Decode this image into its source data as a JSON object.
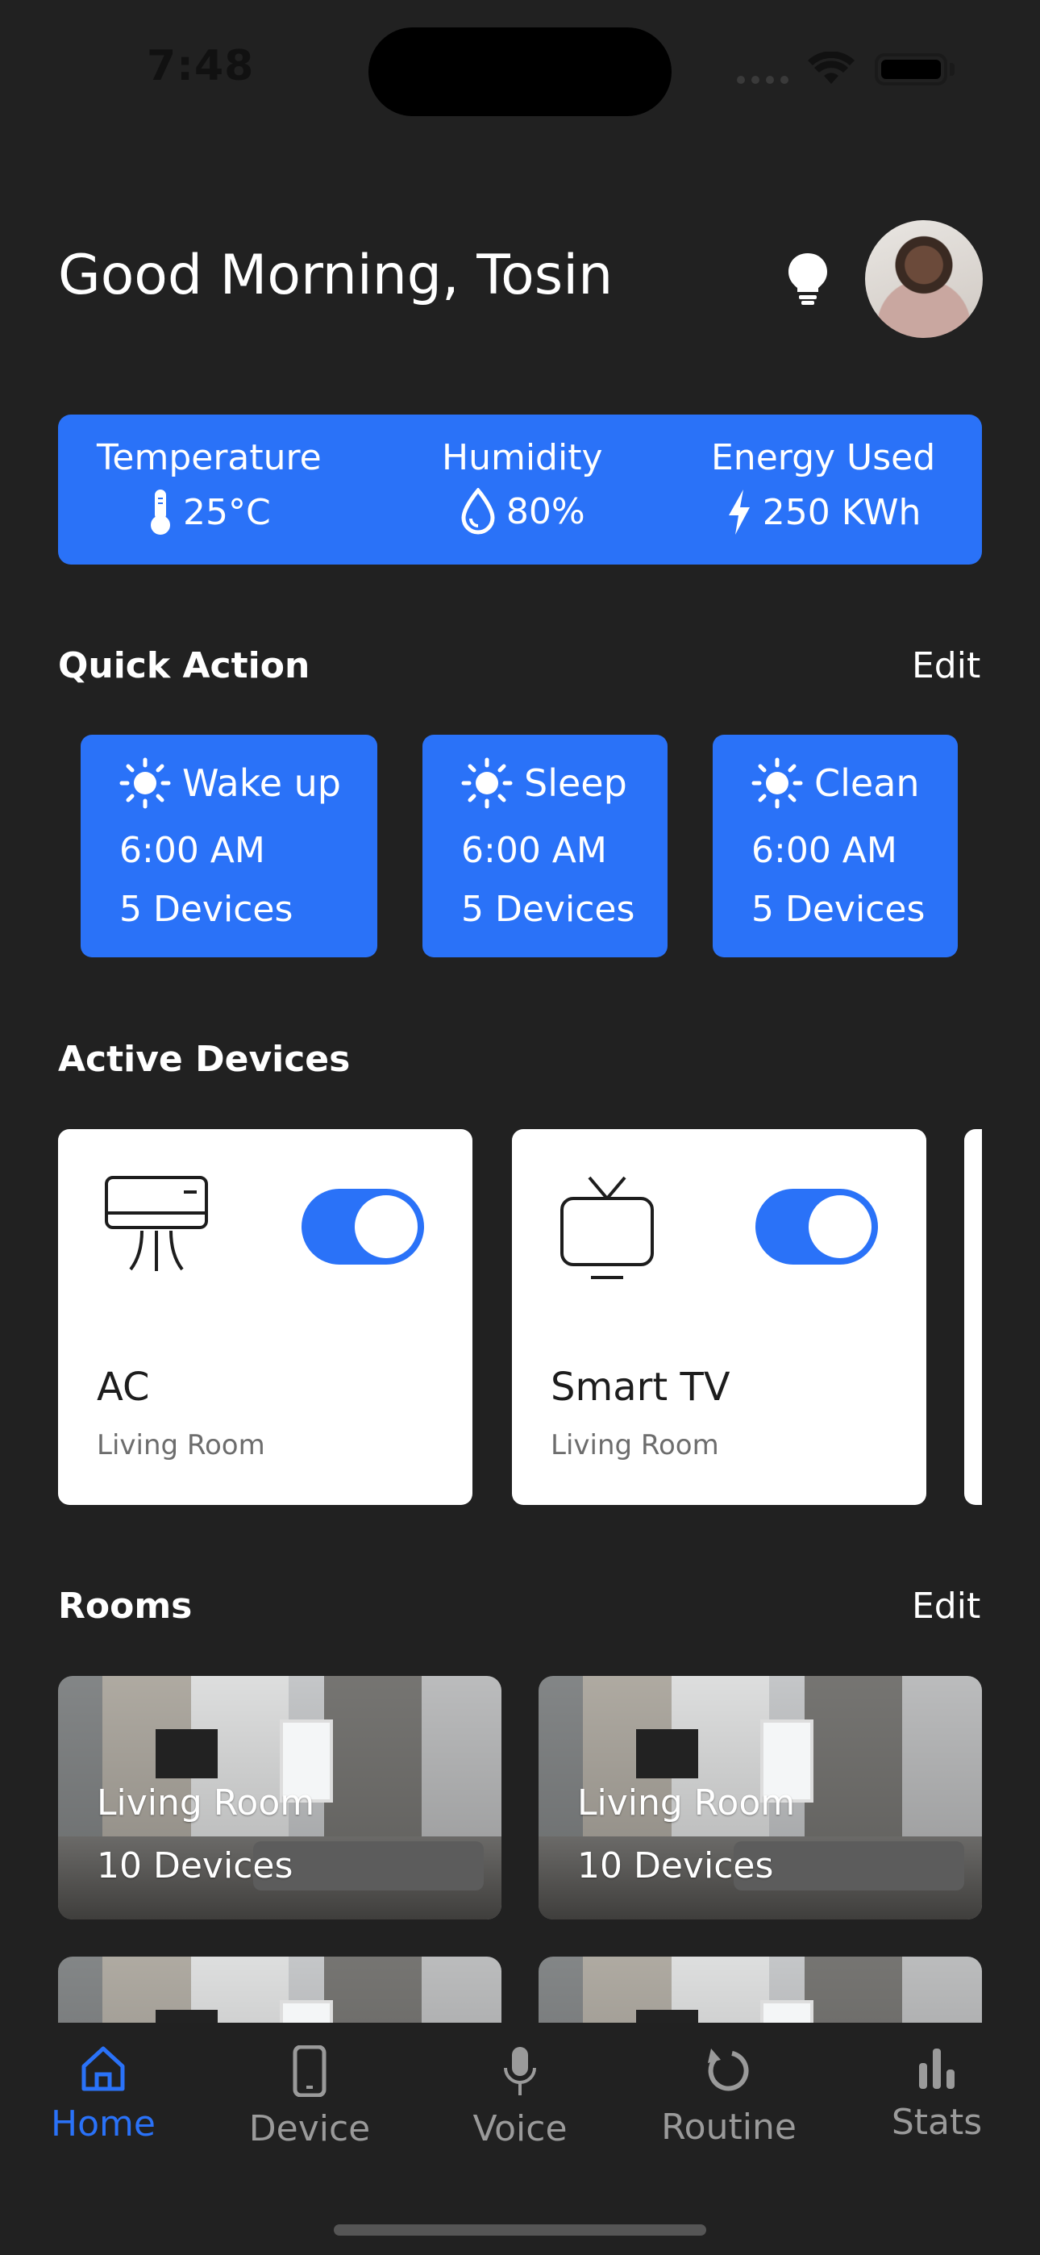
{
  "status_bar": {
    "time": "7:48"
  },
  "header": {
    "greeting": "Good Morning, Tosin"
  },
  "stats": [
    {
      "label": "Temperature",
      "value": "25°C",
      "icon": "thermometer-icon"
    },
    {
      "label": "Humidity",
      "value": "80%",
      "icon": "droplet-icon"
    },
    {
      "label": "Energy Used",
      "value": "250 KWh",
      "icon": "lightning-icon"
    }
  ],
  "quick_action": {
    "title": "Quick Action",
    "edit_label": "Edit",
    "items": [
      {
        "name": "Wake up",
        "time": "6:00 AM",
        "devices": "5 Devices",
        "icon": "sun-icon"
      },
      {
        "name": "Sleep",
        "time": "6:00 AM",
        "devices": "5 Devices",
        "icon": "sun-icon"
      },
      {
        "name": "Clean",
        "time": "6:00 AM",
        "devices": "5 Devices",
        "icon": "sun-icon"
      }
    ]
  },
  "active_devices": {
    "title": "Active Devices",
    "items": [
      {
        "name": "AC",
        "room": "Living Room",
        "on": true,
        "icon": "air-conditioner-icon"
      },
      {
        "name": "Smart TV",
        "room": "Living Room",
        "on": true,
        "icon": "tv-icon"
      }
    ]
  },
  "rooms": {
    "title": "Rooms",
    "edit_label": "Edit",
    "items": [
      {
        "name": "Living Room",
        "devices": "10 Devices"
      },
      {
        "name": "Living Room",
        "devices": "10 Devices"
      },
      {
        "name": "",
        "devices": ""
      },
      {
        "name": "",
        "devices": ""
      }
    ]
  },
  "nav": {
    "items": [
      {
        "label": "Home",
        "icon": "home-icon",
        "active": true
      },
      {
        "label": "Device",
        "icon": "phone-icon",
        "active": false
      },
      {
        "label": "Voice",
        "icon": "microphone-icon",
        "active": false
      },
      {
        "label": "Routine",
        "icon": "refresh-icon",
        "active": false
      },
      {
        "label": "Stats",
        "icon": "bar-chart-icon",
        "active": false
      }
    ]
  },
  "colors": {
    "background": "#212121",
    "accent": "#2a72f8",
    "card": "#ffffff",
    "inactive_nav": "#9a9a9a"
  }
}
